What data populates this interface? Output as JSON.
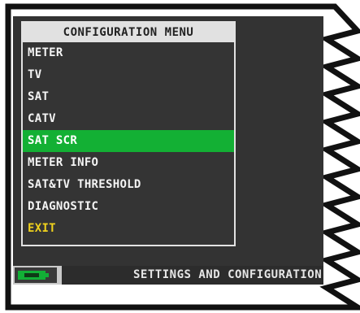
{
  "menu": {
    "title": "CONFIGURATION MENU",
    "items": [
      {
        "label": "METER"
      },
      {
        "label": "TV"
      },
      {
        "label": "SAT"
      },
      {
        "label": "CATV"
      },
      {
        "label": "SAT SCR",
        "selected": true
      },
      {
        "label": "METER INFO"
      },
      {
        "label": "SAT&TV THRESHOLD"
      },
      {
        "label": "DIAGNOSTIC"
      },
      {
        "label": "EXIT"
      }
    ]
  },
  "status": {
    "message": "SETTINGS AND CONFIGURATION",
    "battery_icon": "battery-icon"
  },
  "colors": {
    "screen_bg": "#333333",
    "selection": "#13b034",
    "exit_text": "#f0d21d",
    "battery": "#12b036",
    "title_bg": "#e1e1e1"
  }
}
